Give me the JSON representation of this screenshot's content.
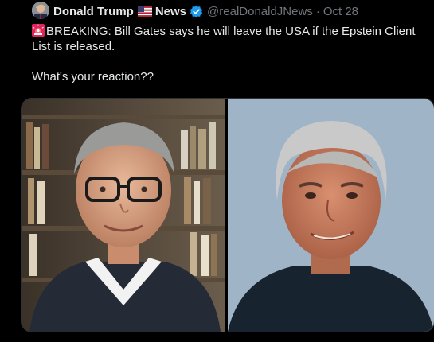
{
  "tweet": {
    "display_name": "Donald Trump",
    "name_suffix": "News",
    "handle": "@realDonaldJNews",
    "separator": "·",
    "date": "Oct 28",
    "text_line1": "BREAKING: Bill Gates says he will leave the USA if the Epstein Client List is released.",
    "text_line2": "What's your reaction??"
  },
  "icons": {
    "flag": "us-flag-icon",
    "verified": "verified-badge-icon",
    "alert": "rotating-light-icon"
  },
  "colors": {
    "background": "#000000",
    "text": "#e7e9ea",
    "secondary_text": "#71767b",
    "verified_blue": "#1d9bf0",
    "border": "#2f3336"
  }
}
